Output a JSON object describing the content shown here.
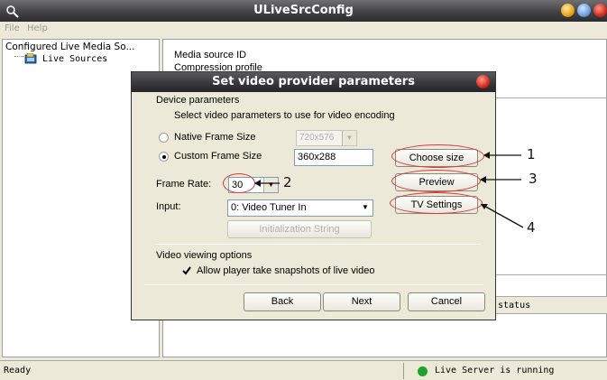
{
  "window": {
    "title": "ULiveSrcConfig"
  },
  "menu": {
    "items": [
      "File",
      "Help"
    ]
  },
  "left_pane": {
    "tree_root": "Configured Live Media So...",
    "tree_child": "Live Sources"
  },
  "right_pane": {
    "line1": "Media source ID",
    "line2": "Compression profile",
    "status_column": "status"
  },
  "statusbar": {
    "ready": "Ready",
    "server": "Live Server is running",
    "server_color": "#1fa22e"
  },
  "dialog": {
    "title": "Set video provider parameters",
    "device_group": "Device parameters",
    "instruction": "Select video parameters to use for video encoding",
    "native_label": "Native Frame Size",
    "native_value": "720x576",
    "custom_label": "Custom Frame Size",
    "custom_value": "360x288",
    "frame_size_selected": "Custom Frame Size",
    "choose_size": "Choose size",
    "frame_rate_label": "Frame Rate:",
    "frame_rate_value": "30",
    "preview": "Preview",
    "input_label": "Input:",
    "input_value": "0: Video Tuner In",
    "tv_settings": "TV Settings",
    "init_string": "Initialization String",
    "viewing_group": "Video viewing options",
    "snapshot_label": "Allow player take snapshots of live video",
    "snapshot_checked": true,
    "back": "Back",
    "next": "Next",
    "cancel": "Cancel"
  },
  "annotations": {
    "n1": "1",
    "n2": "2",
    "n3": "3",
    "n4": "4",
    "highlight_color": "#d43a3a"
  }
}
